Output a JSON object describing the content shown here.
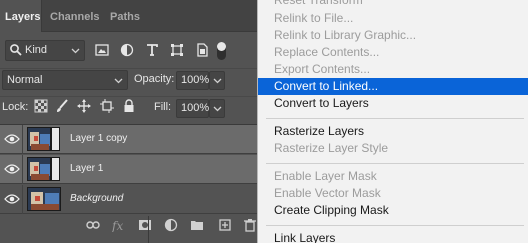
{
  "panel": {
    "tabs": [
      {
        "label": "Layers",
        "active": true
      },
      {
        "label": "Channels",
        "active": false
      },
      {
        "label": "Paths",
        "active": false
      }
    ],
    "filter": {
      "kind_label": "Kind"
    },
    "blend_mode": "Normal",
    "opacity_label": "Opacity:",
    "opacity_value": "100%",
    "lock_label": "Lock:",
    "fill_label": "Fill:",
    "fill_value": "100%",
    "layers": [
      {
        "name": "Layer 1 copy",
        "selected": true,
        "italic": false
      },
      {
        "name": "Layer 1",
        "selected": true,
        "italic": false
      },
      {
        "name": "Background",
        "selected": false,
        "italic": true
      }
    ]
  },
  "menu": {
    "items": [
      {
        "label": "Reset Transform",
        "enabled": false
      },
      {
        "label": "Relink to File...",
        "enabled": false
      },
      {
        "label": "Relink to Library Graphic...",
        "enabled": false
      },
      {
        "label": "Replace Contents...",
        "enabled": false
      },
      {
        "label": "Export Contents...",
        "enabled": false
      },
      {
        "label": "Convert to Linked...",
        "enabled": true,
        "highlighted": true
      },
      {
        "label": "Convert to Layers",
        "enabled": true
      },
      {
        "label": "Rasterize Layers",
        "enabled": true
      },
      {
        "label": "Rasterize Layer Style",
        "enabled": false
      },
      {
        "label": "Enable Layer Mask",
        "enabled": false
      },
      {
        "label": "Enable Vector Mask",
        "enabled": false
      },
      {
        "label": "Create Clipping Mask",
        "enabled": true
      },
      {
        "label": "Link Layers",
        "enabled": true
      }
    ]
  },
  "colors": {
    "panel_bg": "#535353",
    "selected_row": "#6b6b6b",
    "menu_bg": "#f2f2f2",
    "menu_highlight": "#0a64d8",
    "disabled_text": "#9c9c9c"
  }
}
